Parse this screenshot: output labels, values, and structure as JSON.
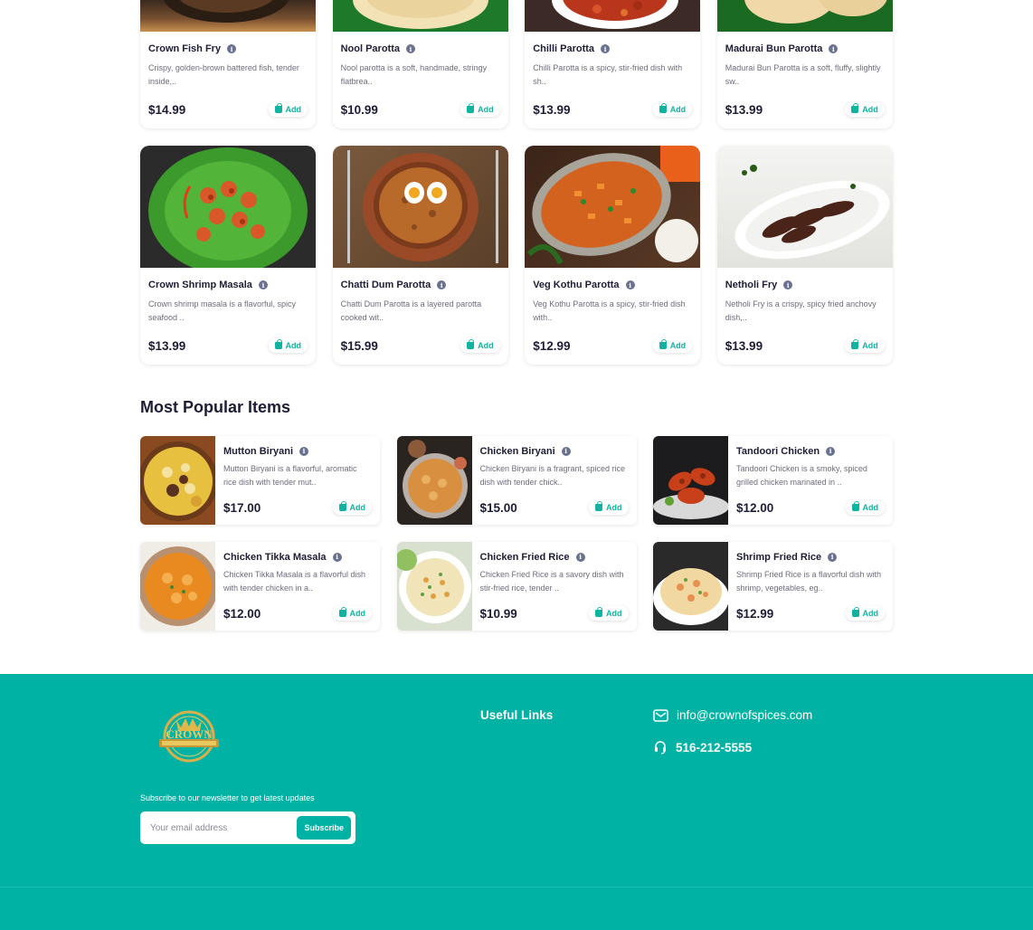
{
  "menu_items": [
    {
      "name": "Crown Fish Fry",
      "desc": "Crispy, golden-brown battered fish, tender inside,..",
      "price": "$14.99"
    },
    {
      "name": "Nool Parotta",
      "desc": "Nool parotta is a soft, handmade, stringy flatbrea..",
      "price": "$10.99"
    },
    {
      "name": "Chilli Parotta",
      "desc": "Chilli Parotta is a spicy, stir-fried dish with sh..",
      "price": "$13.99"
    },
    {
      "name": "Madurai Bun Parotta",
      "desc": "Madurai Bun Parotta is a soft, fluffy, slightly sw..",
      "price": "$13.99"
    },
    {
      "name": "Crown Shrimp Masala",
      "desc": "Crown shrimp masala is a flavorful, spicy seafood ..",
      "price": "$13.99"
    },
    {
      "name": "Chatti Dum Parotta",
      "desc": "Chatti Dum Parotta is a layered parotta cooked wit..",
      "price": "$15.99"
    },
    {
      "name": "Veg Kothu Parotta",
      "desc": "Veg Kothu Parotta is a spicy, stir-fried dish with..",
      "price": "$12.99"
    },
    {
      "name": "Netholi Fry",
      "desc": "Netholi Fry is a crispy, spicy fried anchovy dish,..",
      "price": "$13.99"
    }
  ],
  "add_label": "Add",
  "popular": {
    "title": "Most Popular Items",
    "items": [
      {
        "name": "Mutton Biryani",
        "desc": "Mutton Biryani is a flavorful, aromatic rice dish with tender mut..",
        "price": "$17.00"
      },
      {
        "name": "Chicken Biryani",
        "desc": "Chicken Biryani is a fragrant, spiced rice dish with tender chick..",
        "price": "$15.00"
      },
      {
        "name": "Tandoori Chicken",
        "desc": "Tandoori Chicken is a smoky, spiced grilled chicken marinated in ..",
        "price": "$12.00"
      },
      {
        "name": "Chicken Tikka Masala",
        "desc": "Chicken Tikka Masala is a flavorful dish with tender chicken in a..",
        "price": "$12.00"
      },
      {
        "name": "Chicken Fried Rice",
        "desc": "Chicken Fried Rice is a savory dish with stir-fried rice, tender ..",
        "price": "$10.99"
      },
      {
        "name": "Shrimp Fried Rice",
        "desc": "Shrimp Fried Rice is a flavorful dish with shrimp, vegetables, eg..",
        "price": "$12.99"
      }
    ]
  },
  "footer": {
    "logo_text": "CROWN",
    "subscribe_label": "Subscribe to our newsletter to get latest updates",
    "email_placeholder": "Your email address",
    "subscribe_button": "Subscribe",
    "useful_links_title": "Useful Links",
    "email": "info@crownofspices.com",
    "phone": "516-212-5555"
  },
  "colors": {
    "accent": "#00b2a3",
    "text": "#1d1d35",
    "muted": "#6d6d7d"
  }
}
